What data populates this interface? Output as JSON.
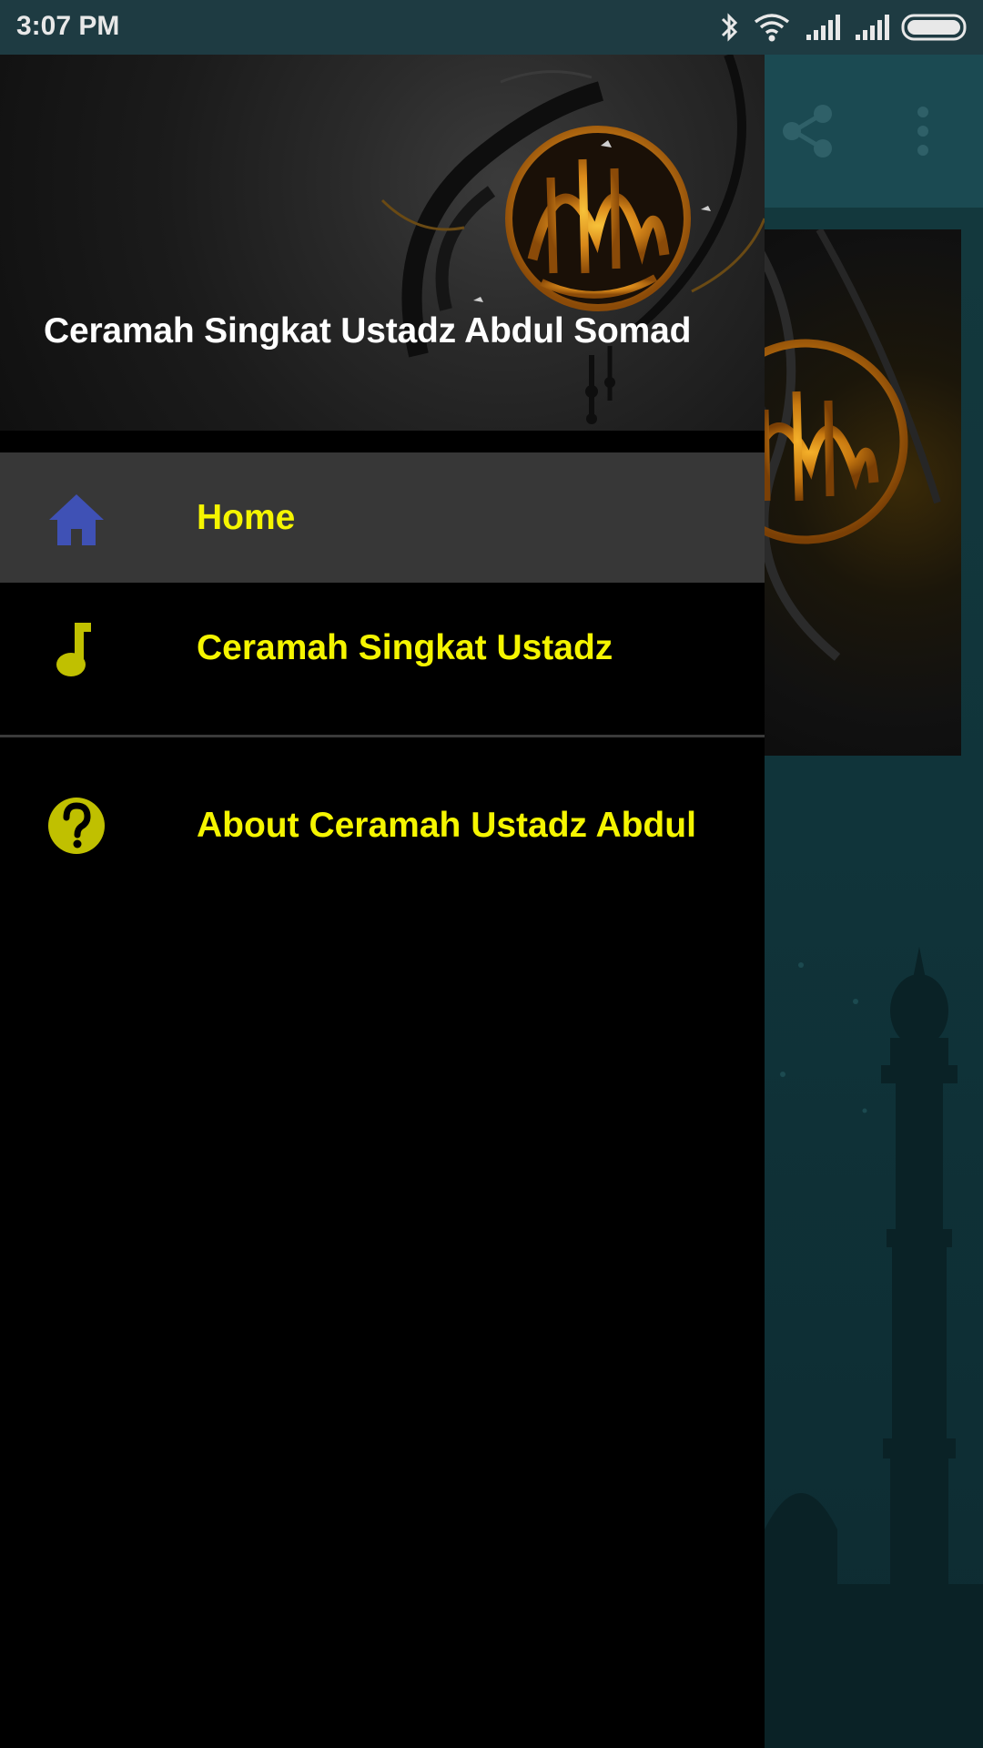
{
  "status_bar": {
    "time": "3:07 PM",
    "icons": [
      "bluetooth-icon",
      "wifi-icon",
      "signal-icon",
      "signal-icon",
      "battery-icon"
    ]
  },
  "app": {
    "toolbar_icons": [
      "share-icon",
      "more-vert-icon"
    ]
  },
  "drawer": {
    "header_title": "Ceramah Singkat Ustadz Abdul Somad",
    "menu": [
      {
        "label": "Home",
        "icon": "home-icon",
        "selected": true
      },
      {
        "label": "Ceramah Singkat Ustadz",
        "icon": "music-note-icon",
        "selected": false
      },
      {
        "label": "About Ceramah Ustadz Abdul",
        "icon": "help-icon",
        "selected": false
      }
    ]
  },
  "colors": {
    "status_bar_bg": "#1e3b42",
    "drawer_bg": "#000000",
    "selected_item_bg": "#373737",
    "menu_label": "#f5f500",
    "home_icon": "#3f51b5",
    "accent_icon": "#c0c000",
    "header_title": "#ffffff",
    "toolbar_bg": "#1b4a52"
  }
}
